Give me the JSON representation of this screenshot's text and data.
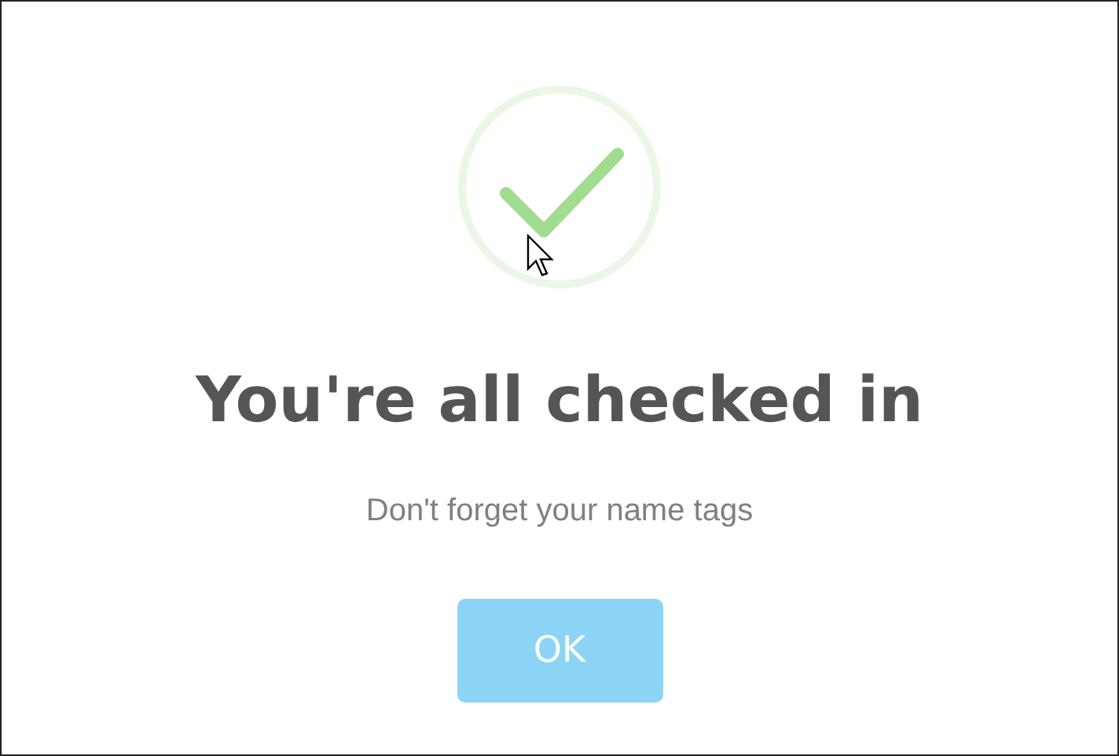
{
  "dialog": {
    "title": "You're all checked in",
    "message": "Don't forget your name tags",
    "button": "OK"
  }
}
